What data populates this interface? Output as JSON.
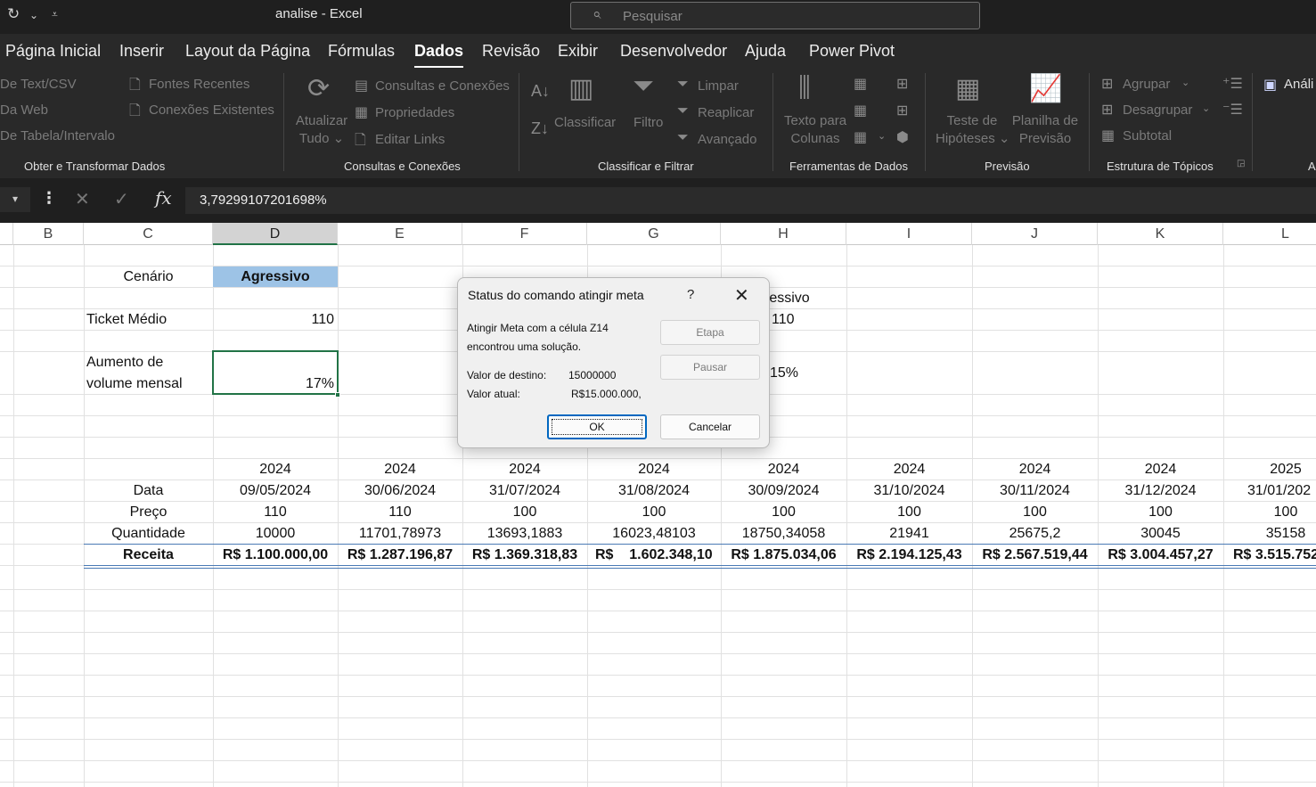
{
  "window": {
    "title": "analise  -  Excel"
  },
  "search": {
    "placeholder": "Pesquisar"
  },
  "tabs": [
    "Página Inicial",
    "Inserir",
    "Layout da Página",
    "Fórmulas",
    "Dados",
    "Revisão",
    "Exibir",
    "Desenvolvedor",
    "Ajuda",
    "Power Pivot"
  ],
  "active_tab": "Dados",
  "ribbon": {
    "get_data": {
      "from_text": "De Text/CSV",
      "from_web": "Da Web",
      "from_table": "De Tabela/Intervalo",
      "recent_sources": "Fontes Recentes",
      "existing_connections": "Conexões Existentes",
      "group": "Obter e Transformar Dados"
    },
    "queries": {
      "refresh_line1": "Atualizar",
      "refresh_line2": "Tudo ⌄",
      "queries_connections": "Consultas e Conexões",
      "properties": "Propriedades",
      "edit_links": "Editar Links",
      "group": "Consultas e Conexões"
    },
    "sort_filter": {
      "sort": "Classificar",
      "filter": "Filtro",
      "clear": "Limpar",
      "reapply": "Reaplicar",
      "advanced": "Avançado",
      "group": "Classificar e Filtrar"
    },
    "data_tools": {
      "text_to_columns_line1": "Texto para",
      "text_to_columns_line2": "Colunas",
      "group": "Ferramentas de Dados"
    },
    "forecast": {
      "whatif_line1": "Teste de",
      "whatif_line2": "Hipóteses ⌄",
      "sheet_line1": "Planilha de",
      "sheet_line2": "Previsão",
      "group": "Previsão"
    },
    "outline": {
      "group_btn": "Agrupar",
      "ungroup_btn": "Desagrupar",
      "subtotal": "Subtotal",
      "group": "Estrutura de Tópicos"
    },
    "analysis": {
      "label": "Análi",
      "group_short": "A"
    }
  },
  "formula_bar": {
    "value": "3,79299107201698%"
  },
  "columns": [
    "B",
    "C",
    "D",
    "E",
    "F",
    "G",
    "H",
    "I",
    "J",
    "K",
    "L"
  ],
  "selected_column": "D",
  "sheet": {
    "scenario_label": "Cenário",
    "scenario_value": "Agressivo",
    "ticket_label": "Ticket Médio",
    "ticket_value": "110",
    "volume_label_line1": "Aumento de",
    "volume_label_line2": "volume mensal",
    "volume_value": "17%",
    "h_scenario_partial": "ressivo",
    "h_ticket": "110",
    "h_volume": "15%",
    "row_labels": {
      "data": "Data",
      "preco": "Preço",
      "quantidade": "Quantidade",
      "receita": "Receita"
    },
    "years": [
      "2024",
      "2024",
      "2024",
      "2024",
      "2024",
      "2024",
      "2024",
      "2024",
      "2025"
    ],
    "dates": [
      "09/05/2024",
      "30/06/2024",
      "31/07/2024",
      "31/08/2024",
      "30/09/2024",
      "31/10/2024",
      "30/11/2024",
      "31/12/2024",
      "31/01/202"
    ],
    "prices": [
      "110",
      "110",
      "100",
      "100",
      "100",
      "100",
      "100",
      "100",
      "100"
    ],
    "quantities": [
      "10000",
      "11701,78973",
      "13693,1883",
      "16023,48103",
      "18750,34058",
      "21941",
      "25675,2",
      "30045",
      "35158"
    ],
    "revenues": [
      "R$ 1.100.000,00",
      "R$ 1.287.196,87",
      "R$ 1.369.318,83",
      "R$    1.602.348,10",
      "R$ 1.875.034,06",
      "R$ 2.194.125,43",
      "R$ 2.567.519,44",
      "R$ 3.004.457,27",
      "R$ 3.515.752"
    ]
  },
  "dialog": {
    "title": "Status do comando atingir meta",
    "help": "?",
    "message_line1": "Atingir Meta com a célula Z14",
    "message_line2": "encontrou uma solução.",
    "target_label": "Valor de destino:",
    "target_value": "15000000",
    "current_label": "Valor atual:",
    "current_value": "R$15.000.000,",
    "step_btn": "Etapa",
    "pause_btn": "Pausar",
    "ok_btn": "OK",
    "cancel_btn": "Cancelar"
  }
}
